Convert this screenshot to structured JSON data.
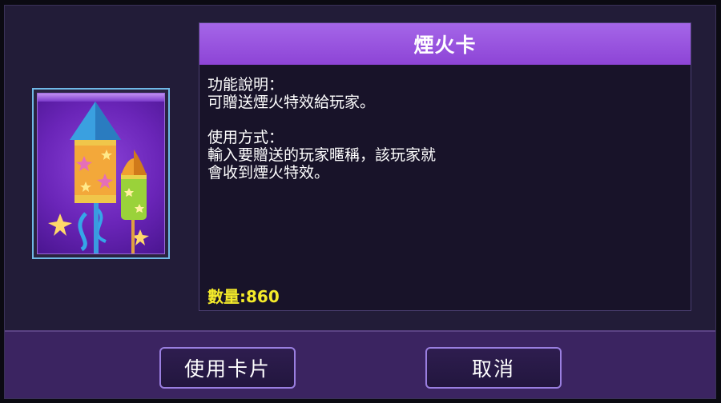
{
  "card": {
    "title": "煙火卡",
    "icon": "firework-rockets-icon",
    "description": "功能說明：\n可贈送煙火特效給玩家。\n\n使用方式：\n輸入要贈送的玩家暱稱，該玩家就\n會收到煙火特效。",
    "quantity_label": "數量:860"
  },
  "buttons": {
    "use_label": "使用卡片",
    "cancel_label": "取消"
  },
  "colors": {
    "header": "#9b55e0",
    "quantity": "#f4ea2a",
    "button_border": "#9a7fe0",
    "footer": "#3b2461"
  }
}
